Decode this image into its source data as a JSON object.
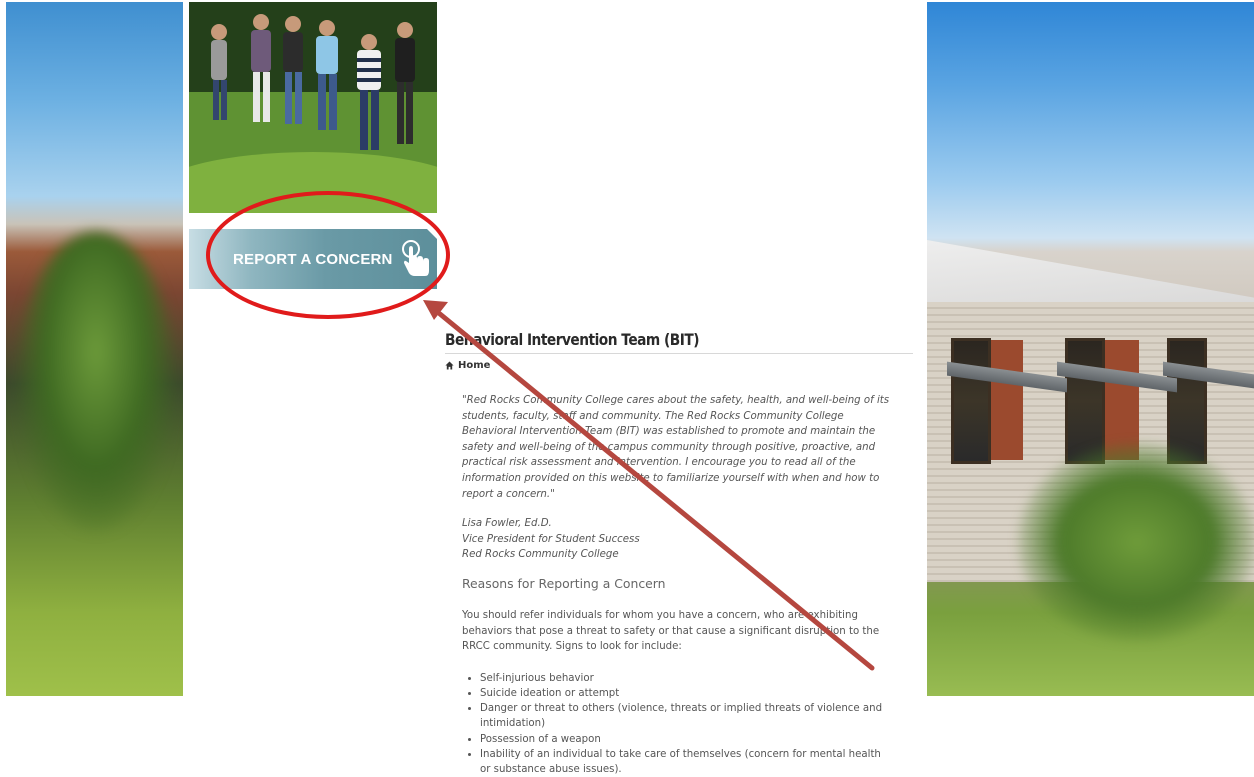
{
  "report_button": {
    "label": "REPORT A CONCERN"
  },
  "page": {
    "title": "Behavioral Intervention Team (BIT)",
    "breadcrumb": "Home"
  },
  "quote": "\"Red Rocks Community College cares about the safety, health, and well-being of its students, faculty, staff and community. The Red Rocks Community College Behavioral Intervention Team (BIT) was established to promote and maintain the safety and well-being of the campus community through positive, proactive, and practical risk assessment and intervention. I encourage you to read all of the information provided on this website to familiarize yourself with when and how to report a concern.\"",
  "signature": [
    "Lisa Fowler, Ed.D.",
    "Vice President for Student Success",
    "Red Rocks Community College"
  ],
  "section": {
    "heading": "Reasons for Reporting a Concern",
    "intro": "You should refer individuals for whom you have a concern, who are exhibiting behaviors that pose a threat to safety or that cause a significant disruption to the RRCC community. Signs to look for include:",
    "signs": [
      "Self-injurious behavior",
      "Suicide ideation or attempt",
      "Danger or threat to others (violence, threats or implied threats of violence and intimidation)",
      "Possession of a weapon",
      "Inability of an individual to take care of themselves (concern for mental health or substance abuse issues)."
    ]
  },
  "colors": {
    "annotation_circle": "#e01b1b",
    "annotation_arrow": "#b5473f",
    "report_button": "#6a9aa6"
  },
  "icons": {
    "report_button": "hand-pointer-icon",
    "breadcrumb": "home-icon"
  }
}
